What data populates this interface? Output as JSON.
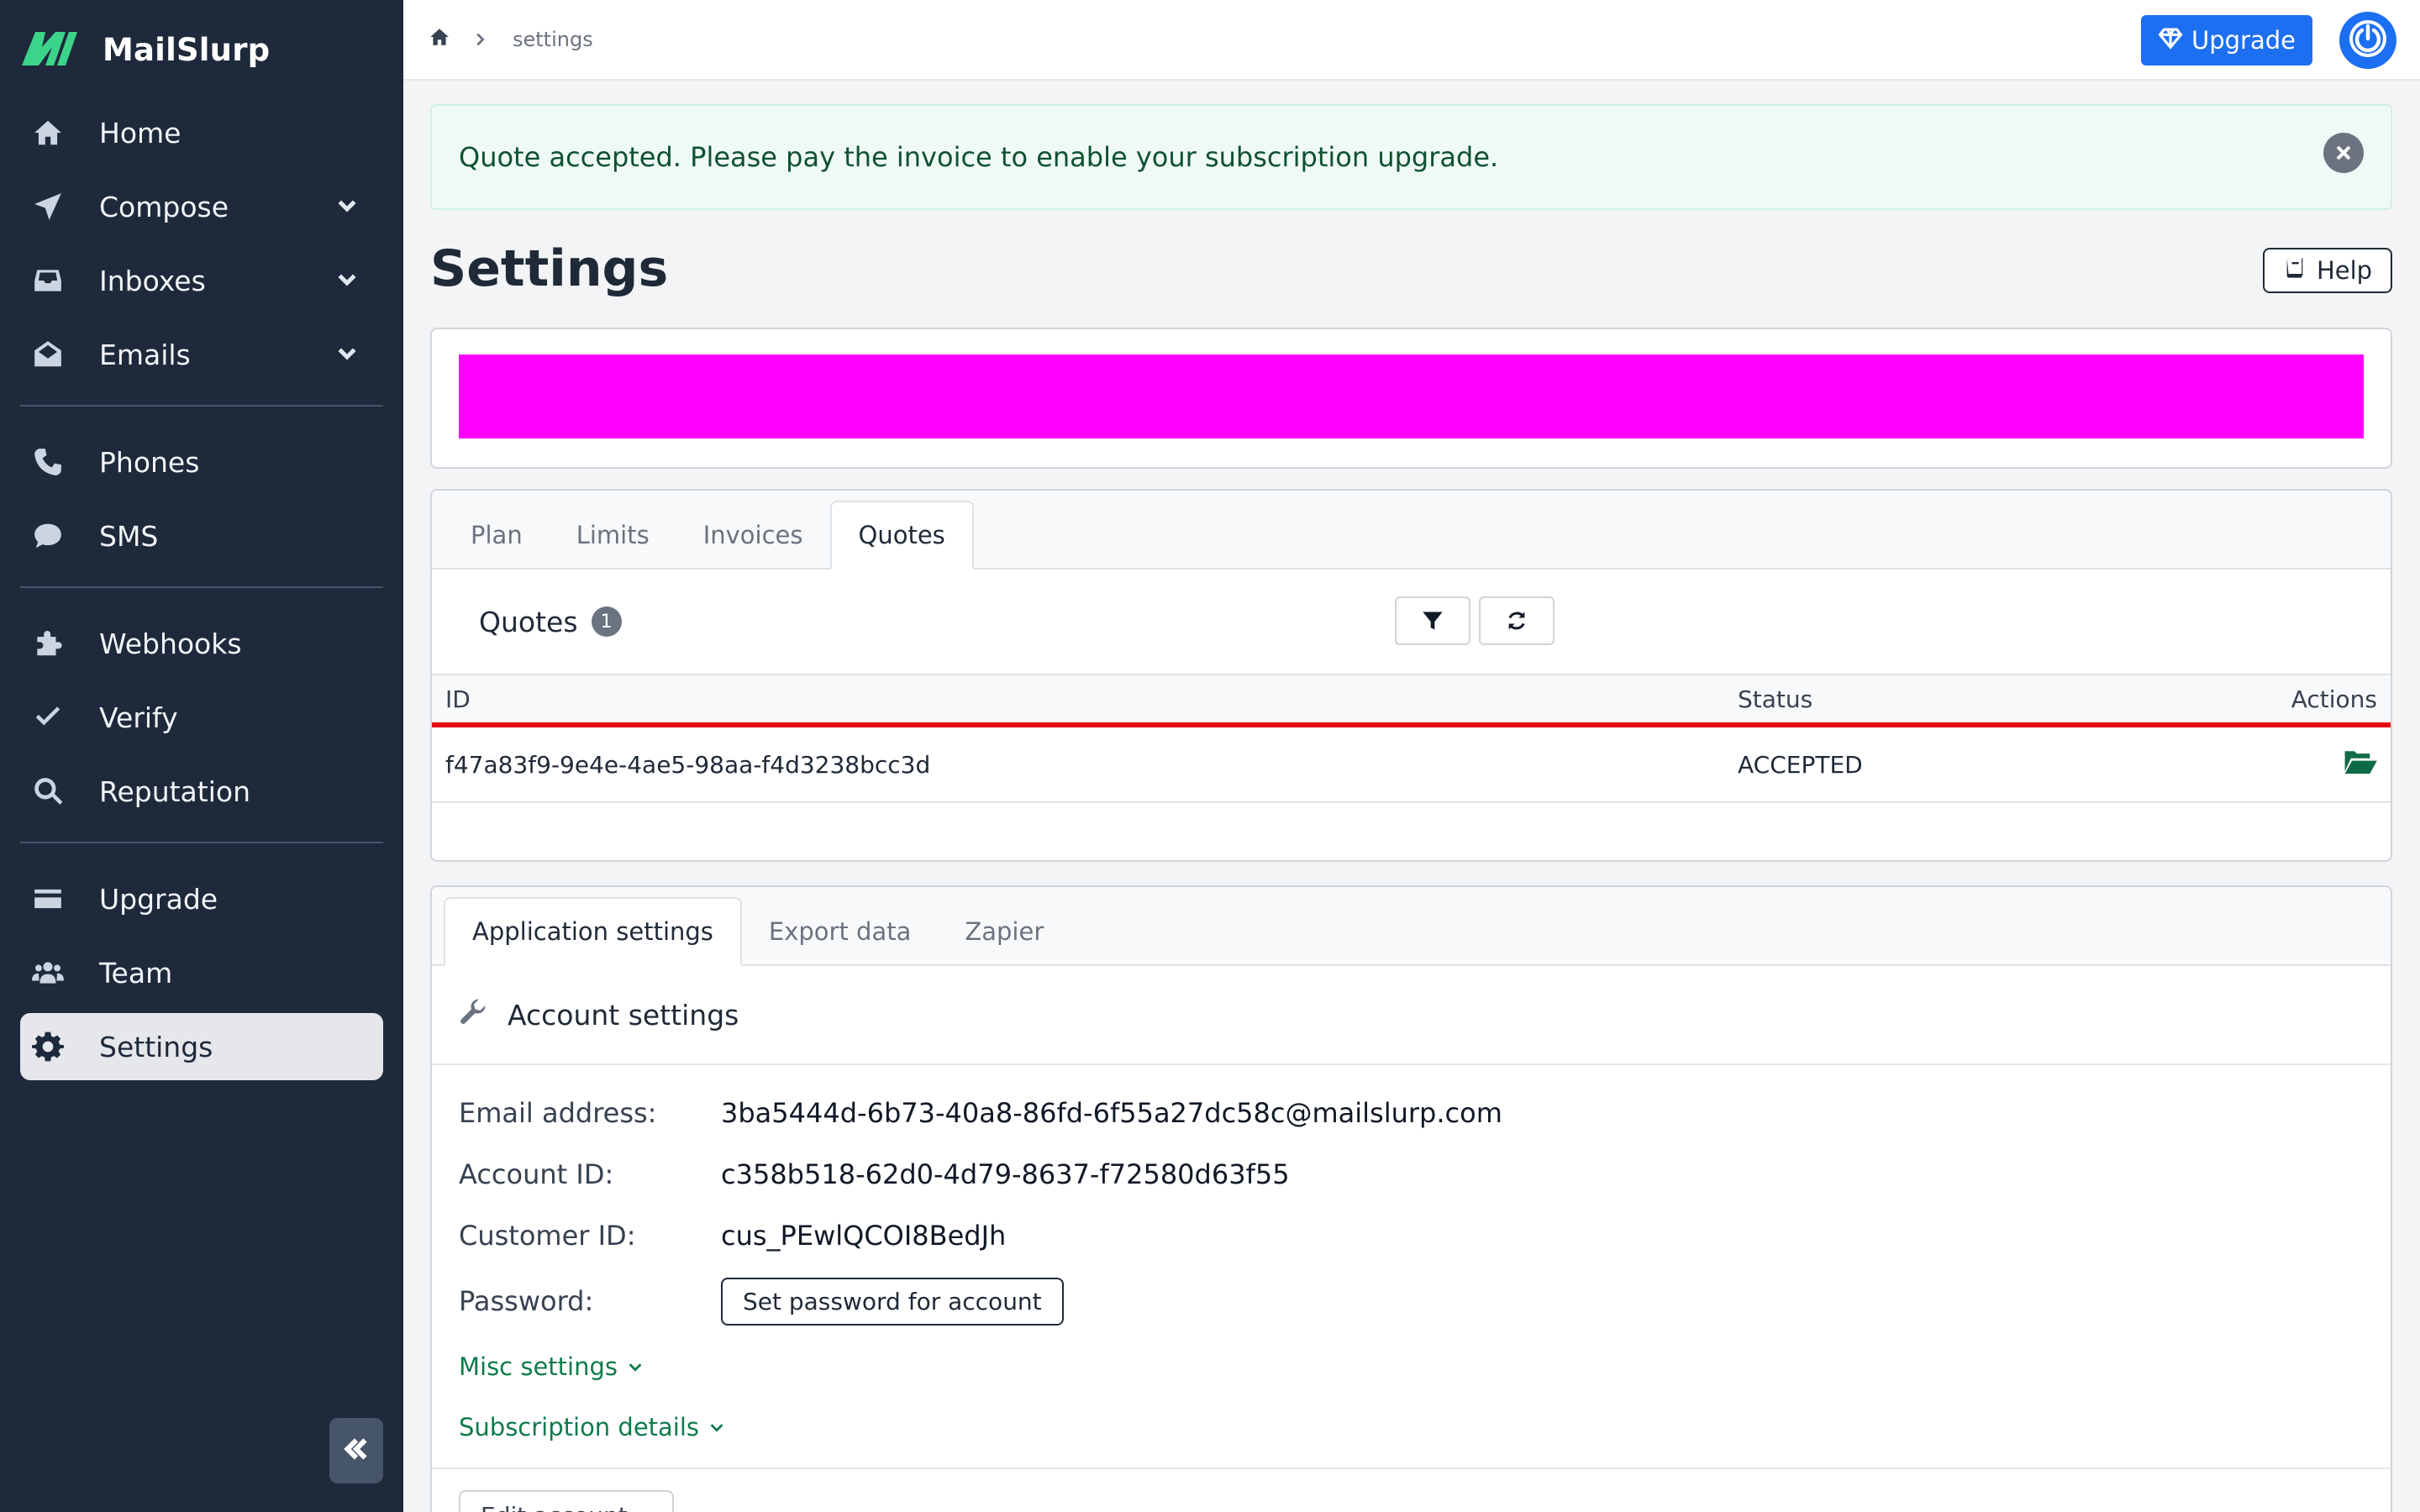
{
  "brand": {
    "name": "MailSlurp"
  },
  "sidebar": {
    "items": [
      {
        "label": "Home"
      },
      {
        "label": "Compose"
      },
      {
        "label": "Inboxes"
      },
      {
        "label": "Emails"
      },
      {
        "label": "Phones"
      },
      {
        "label": "SMS"
      },
      {
        "label": "Webhooks"
      },
      {
        "label": "Verify"
      },
      {
        "label": "Reputation"
      },
      {
        "label": "Upgrade"
      },
      {
        "label": "Team"
      },
      {
        "label": "Settings"
      }
    ]
  },
  "topbar": {
    "breadcrumb": "settings",
    "upgrade_label": "Upgrade"
  },
  "alert": {
    "message": "Quote accepted. Please pay the invoice to enable your subscription upgrade."
  },
  "page": {
    "title": "Settings",
    "help_label": "Help"
  },
  "banner": {
    "color": "#ff00ff"
  },
  "billing": {
    "tabs": [
      "Plan",
      "Limits",
      "Invoices",
      "Quotes"
    ],
    "active_tab": "Quotes",
    "quotes_title": "Quotes",
    "quotes_count": "1",
    "columns": [
      "ID",
      "Status",
      "Actions"
    ],
    "rows": [
      {
        "id": "f47a83f9-9e4e-4ae5-98aa-f4d3238bcc3d",
        "status": "ACCEPTED"
      }
    ]
  },
  "settings": {
    "tabs": [
      "Application settings",
      "Export data",
      "Zapier"
    ],
    "active_tab": "Application settings",
    "section_title": "Account settings",
    "fields": [
      {
        "label": "Email address:",
        "value": "3ba5444d-6b73-40a8-86fd-6f55a27dc58c@mailslurp.com"
      },
      {
        "label": "Account ID:",
        "value": "c358b518-62d0-4d79-8637-f72580d63f55"
      },
      {
        "label": "Customer ID:",
        "value": "cus_PEwlQCOI8BedJh"
      },
      {
        "label": "Password:",
        "value": ""
      }
    ],
    "password_button": "Set password for account",
    "misc_label": "Misc settings",
    "subscription_label": "Subscription details",
    "edit_account_label": "Edit account"
  },
  "colors": {
    "sidebar_bg": "#1e293b",
    "accent": "#1d6ff2",
    "link_green": "#0f7b4b",
    "table_rule": "#e30613"
  }
}
